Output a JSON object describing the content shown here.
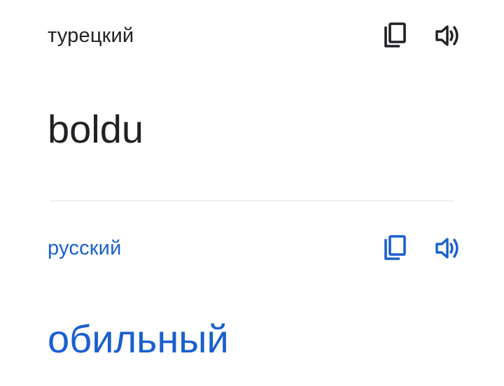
{
  "source": {
    "language": "турецкий",
    "text": "boldu",
    "copy_icon": "copy-icon",
    "speaker_icon": "volume-icon"
  },
  "target": {
    "language": "русский",
    "text": "обильный",
    "copy_icon": "copy-icon",
    "speaker_icon": "volume-icon"
  },
  "colors": {
    "source_text": "#202124",
    "accent": "#1a5fd0",
    "divider": "#eeeff1",
    "background": "#ffffff"
  }
}
